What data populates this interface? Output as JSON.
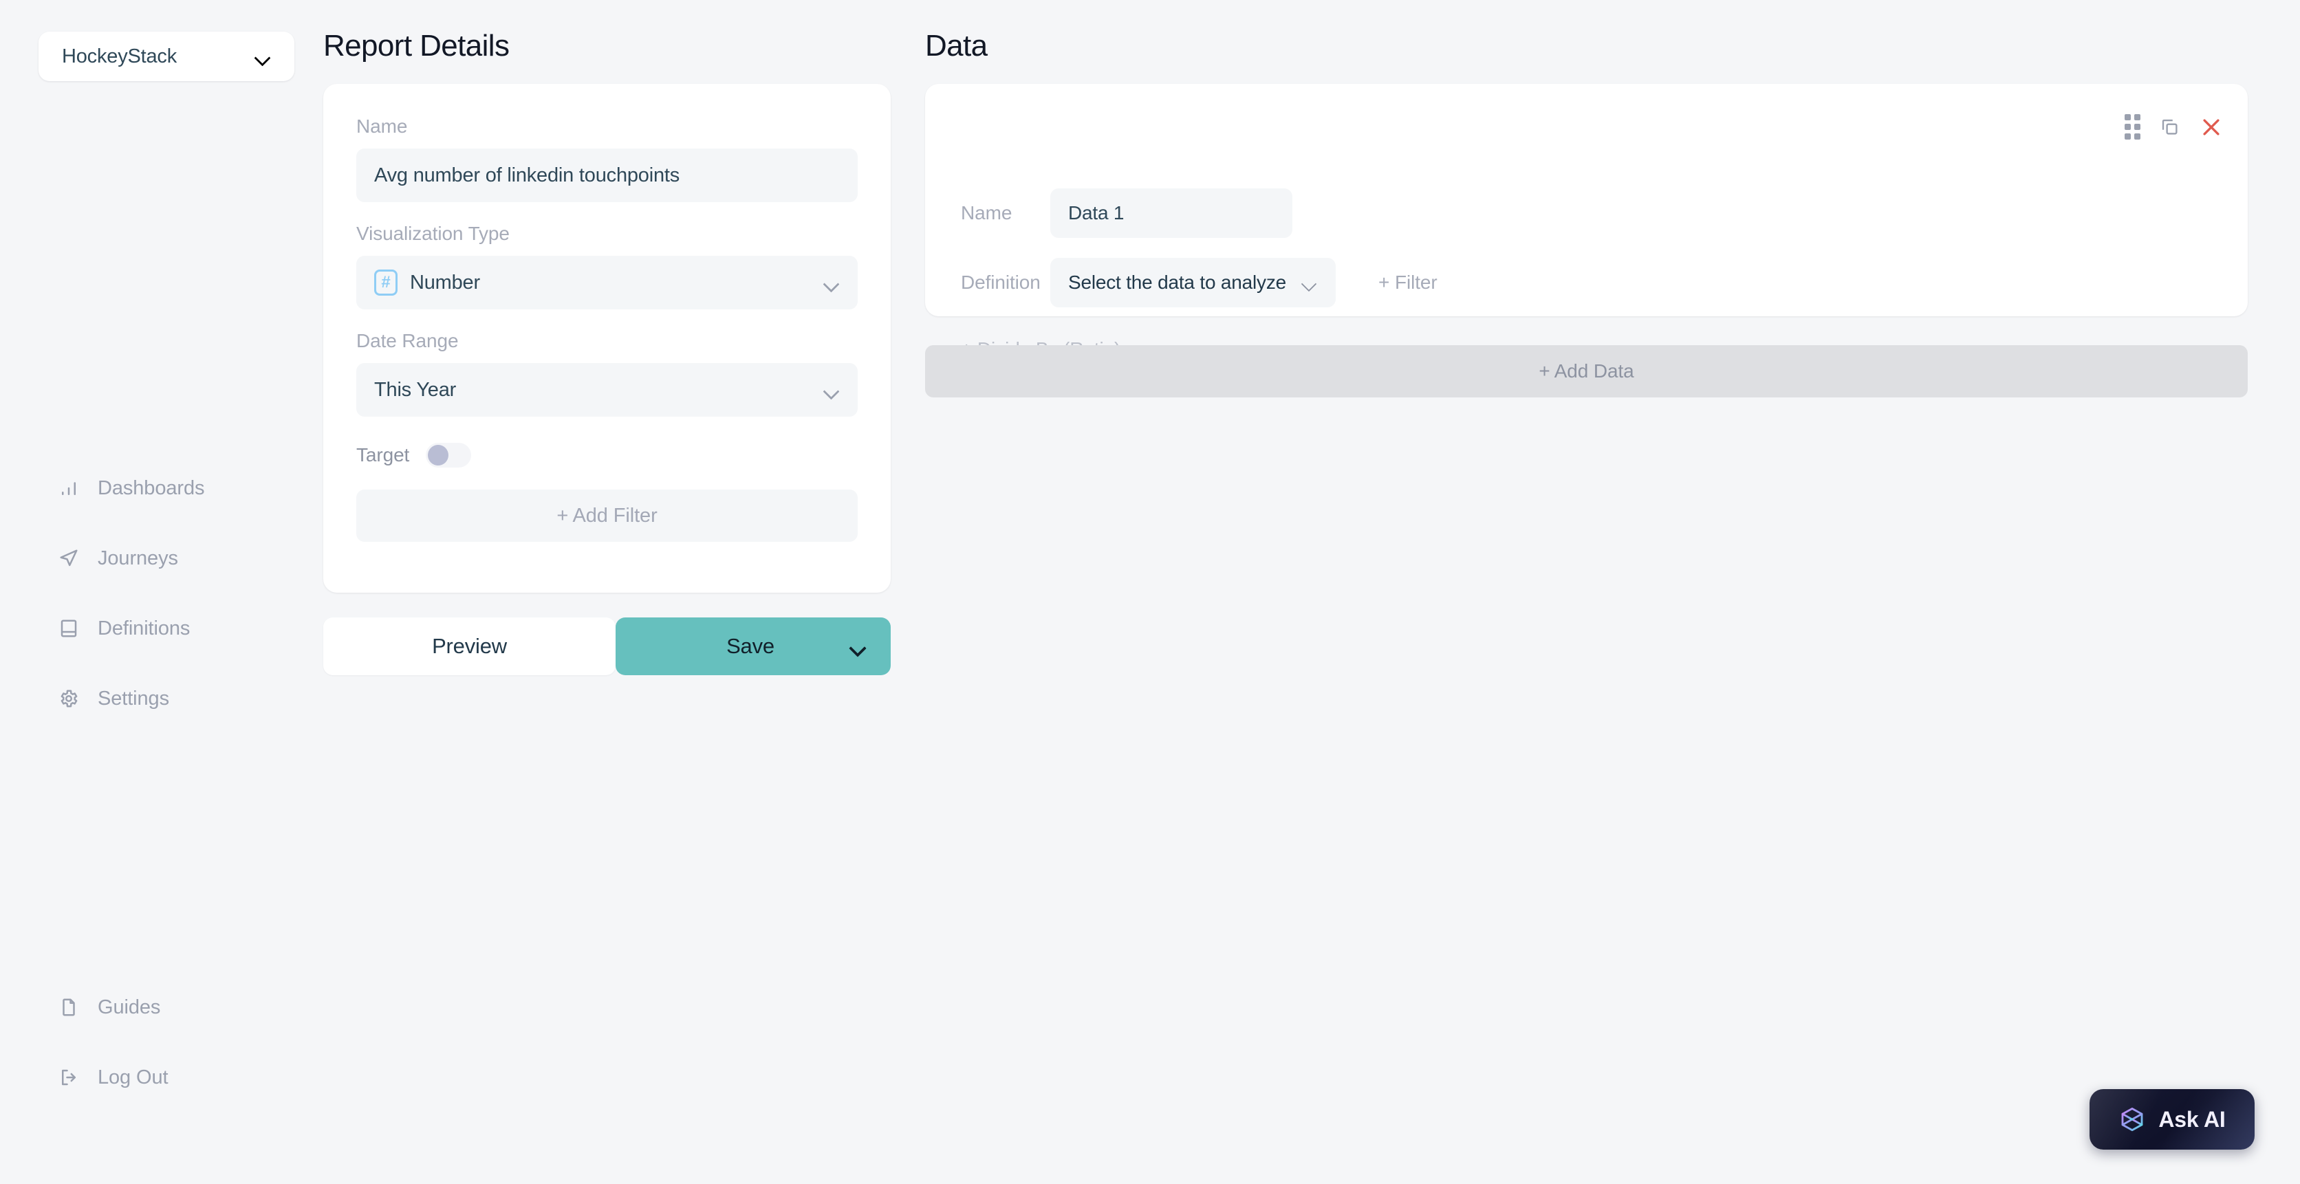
{
  "sidebar": {
    "org_switcher": {
      "label": "HockeyStack",
      "icon": "chevron-down-icon"
    },
    "main_items": [
      {
        "label": "Dashboards",
        "icon": "bar-chart-icon"
      },
      {
        "label": "Journeys",
        "icon": "navigation-arrow-icon"
      },
      {
        "label": "Definitions",
        "icon": "book-icon"
      },
      {
        "label": "Settings",
        "icon": "gear-icon"
      }
    ],
    "bottom_items": [
      {
        "label": "Guides",
        "icon": "file-icon"
      },
      {
        "label": "Log Out",
        "icon": "logout-icon"
      }
    ]
  },
  "report_details": {
    "title": "Report Details",
    "name": {
      "label": "Name",
      "value": "Avg number of linkedin touchpoints",
      "placeholder": "Name"
    },
    "visualization_type": {
      "label": "Visualization Type",
      "value": "Number",
      "icon": "hash-number-icon"
    },
    "date_range": {
      "label": "Date Range",
      "value": "This Year"
    },
    "target": {
      "label": "Target",
      "enabled": false
    },
    "add_filter_label": "+ Add Filter",
    "actions": {
      "preview_label": "Preview",
      "save_label": "Save"
    }
  },
  "data_panel": {
    "title": "Data",
    "card": {
      "name_label": "Name",
      "name_value": "Data 1",
      "name_placeholder": "Data 1",
      "definition_label": "Definition",
      "definition_value": "Select the data to analyze",
      "filter_label": "+ Filter",
      "divide_by_label": "+ Divide By (Ratio)",
      "icons": [
        "drag-handle-icon",
        "duplicate-icon",
        "close-icon"
      ]
    },
    "add_data_label": "+ Add Data"
  },
  "ask_ai": {
    "label": "Ask AI",
    "icon": "hexagon-cube-icon"
  },
  "colors": {
    "page_bg": "#f5f6f8",
    "card_bg": "#ffffff",
    "field_bg": "#f4f6f8",
    "accent_teal": "#66c0be",
    "muted_text": "#a6abb8",
    "dark_text": "#2f4858",
    "close_red": "#e05a4e",
    "hash_blue": "#8fcdf5",
    "add_data_bg": "#dedfe2"
  }
}
